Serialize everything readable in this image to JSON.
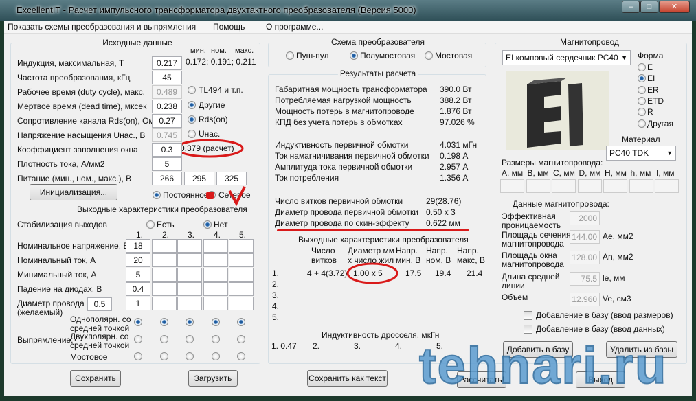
{
  "window": {
    "title": "ExcellentIT - Расчет импульсного трансформатора двухтактного преобразователя (Версия 5000)",
    "minimize": "–",
    "maximize": "□",
    "close": "✕"
  },
  "menu": [
    "Показать схемы преобразования и выпрямления",
    "Помощь",
    "О программе..."
  ],
  "input": {
    "title": "Исходные данные",
    "col_headers": [
      "мин.",
      "ном.",
      "макс."
    ],
    "induction_range": "0.172; 0.191; 0.211",
    "rows": [
      {
        "label": "Индукция, максимальная, Т",
        "value": "0.217"
      },
      {
        "label": "Частота преобразования, кГц",
        "value": "45"
      },
      {
        "label": "Рабочее время (duty cycle), макс.",
        "value": "0.489"
      },
      {
        "label": "Мертвое время (dead time), мксек",
        "value": "0.238"
      },
      {
        "label": "Сопротивление канала Rds(on), Ом",
        "value": "0.27"
      },
      {
        "label": "Напряжение насыщения Uнас., В",
        "value": "0.745"
      },
      {
        "label": "Коэффициент заполнения окна",
        "value": "0.3"
      },
      {
        "label": "Плотность тока, А/мм2",
        "value": "5"
      },
      {
        "label": "Питание (мин., ном., макс.), В",
        "value": "266"
      }
    ],
    "supply_nom": "295",
    "supply_max": "325",
    "fill_calc": "0.379 (расчет)",
    "radios": {
      "tl494": "TL494 и т.п.",
      "other": "Другие",
      "rds": "Rds(on)",
      "usat": "Uнас."
    },
    "init_button": "Инициализация...",
    "supply_type": {
      "dc": "Постоянное",
      "ac": "Сетевое"
    }
  },
  "outputs": {
    "title": "Выходные характеристики преобразователя",
    "stab_label": "Стабилизация выходов",
    "stab_yes": "Есть",
    "stab_no": "Нет",
    "cols": [
      "1.",
      "2.",
      "3.",
      "4.",
      "5."
    ],
    "rows": [
      {
        "label": "Номинальное напряжение, В",
        "values": [
          "18",
          "",
          "",
          "",
          ""
        ]
      },
      {
        "label": "Номинальный ток, А",
        "values": [
          "20",
          "",
          "",
          "",
          ""
        ]
      },
      {
        "label": "Минимальный ток, А",
        "values": [
          "5",
          "",
          "",
          "",
          ""
        ]
      },
      {
        "label": "Падение на диодах, В",
        "values": [
          "0.4",
          "",
          "",
          "",
          ""
        ]
      },
      {
        "label": "Диаметр провода",
        "values": [
          "1",
          "",
          "",
          "",
          ""
        ]
      }
    ],
    "wire_desired_label2": "(желаемый)",
    "wire_desired": "0.5",
    "rect_label": "Выпрямление:",
    "rect_opts": [
      "Однополярн. со",
      "средней точкой",
      "Двухполярн. со",
      "средней точкой",
      "Мостовое"
    ],
    "save": "Сохранить",
    "load": "Загрузить"
  },
  "scheme": {
    "title": "Схема преобразователя",
    "opts": [
      "Пуш-пул",
      "Полумостовая",
      "Мостовая"
    ]
  },
  "results": {
    "title": "Результаты расчета",
    "rows": [
      [
        "Габаритная мощность трансформатора",
        "390.0 Вт"
      ],
      [
        "Потребляемая нагрузкой мощность",
        "388.2 Вт"
      ],
      [
        "Мощность потерь в магнитопроводе",
        "1.876 Вт"
      ],
      [
        "КПД без учета потерь в обмотках",
        "97.026 %"
      ],
      [
        "Индуктивность первичной обмотки",
        "4.031 мГн"
      ],
      [
        "Ток намагничивания первичной обмотки",
        "0.198 А"
      ],
      [
        "Амплитуда тока первичной обмотки",
        "2.957 А"
      ],
      [
        "Ток потребления",
        "1.356 А"
      ],
      [
        "Число витков первичной обмотки",
        "29(28.76)"
      ],
      [
        "Диаметр провода первичной обмотки",
        "0.50 x 3"
      ],
      [
        "Диаметр провода по скин-эффекту",
        "0.622 мм"
      ]
    ],
    "out_title": "Выходные характеристики преобразователя",
    "out_headers": [
      [
        "Число",
        "витков"
      ],
      [
        "Диаметр мм",
        "x число жил"
      ],
      [
        "Напр.",
        "мин, В"
      ],
      [
        "Напр.",
        "ном, В"
      ],
      [
        "Напр.",
        "макс, В"
      ]
    ],
    "out_rows": [
      [
        "1.",
        "4 + 4(3.72)",
        "1.00 x 5",
        "17.5",
        "19.4",
        "21.4"
      ],
      [
        "2."
      ],
      [
        "3."
      ],
      [
        "4."
      ],
      [
        "5."
      ]
    ],
    "choke_title": "Индуктивность дросселя, мкГн",
    "choke": [
      "1. 0.47",
      "2.",
      "3.",
      "4.",
      "5."
    ],
    "save_text": "Сохранить как текст",
    "calc": "Рассчитать!",
    "exit": "Выход"
  },
  "core": {
    "title": "Магнитопровод",
    "core_select": "EI комповый сердечник PC40 TDK",
    "shape_label": "Форма",
    "shapes": [
      "E",
      "EI",
      "ER",
      "ETD",
      "R",
      "Другая"
    ],
    "material_label": "Материал",
    "material": "PC40 TDK",
    "dims_label": "Размеры магнитопровода:",
    "dims": [
      "A, мм",
      "B, мм",
      "C, мм",
      "D, мм",
      "H, мм",
      "h, мм",
      "I, мм"
    ],
    "data_label": "Данные магнитопровода:",
    "params": [
      {
        "l1": "Эффективная",
        "l2": "проницаемость",
        "v": "2000",
        "u": ""
      },
      {
        "l1": "Площадь сечения",
        "l2": "магнитопровода",
        "v": "144.00",
        "u": "Ae, мм2"
      },
      {
        "l1": "Площадь окна",
        "l2": "магнитопровода",
        "v": "128.00",
        "u": "An, мм2"
      },
      {
        "l1": "Длина средней",
        "l2": "линии",
        "v": "75.5",
        "u": "le, мм"
      },
      {
        "l1": "Объем",
        "l2": "",
        "v": "12.960",
        "u": "Ve, см3"
      }
    ],
    "cb1": "Добавление в базу (ввод размеров)",
    "cb2": "Добавление в базу (ввод данных)",
    "add": "Добавить в базу",
    "del": "Удалить из базы"
  },
  "watermark": "tehnari.ru",
  "colors": {
    "annotation": "#d91a1a",
    "accent": "#2d6fb7"
  }
}
